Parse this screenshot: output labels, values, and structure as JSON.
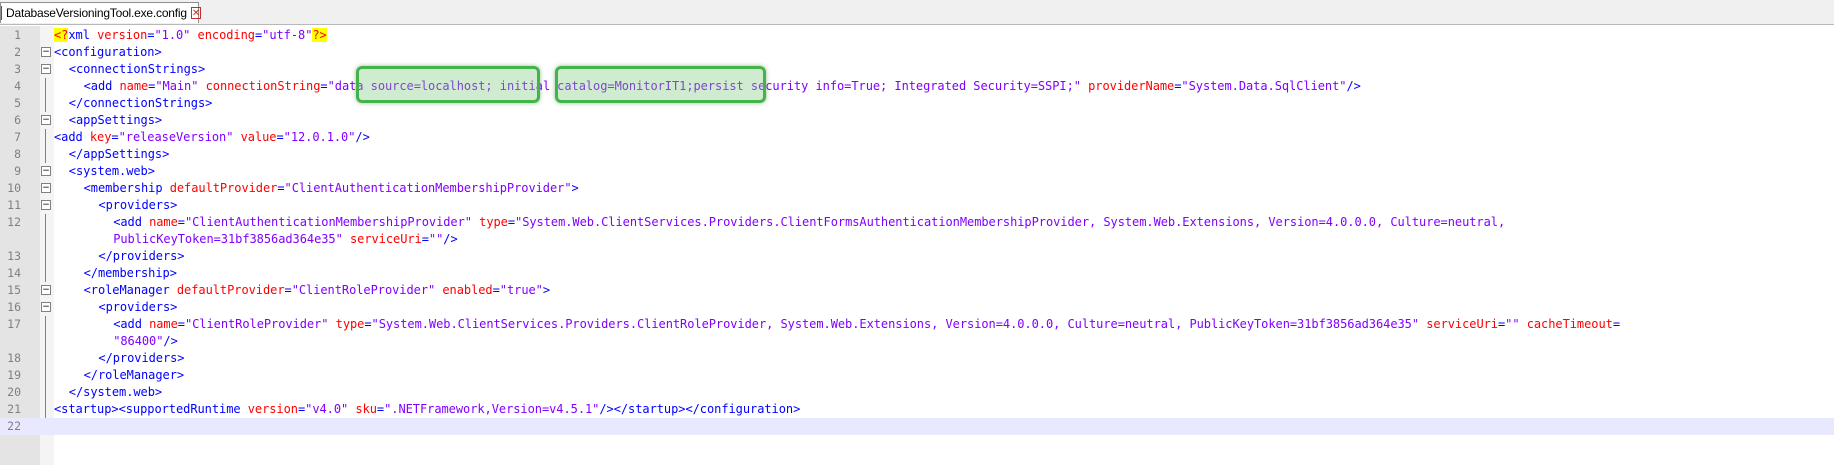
{
  "tab": {
    "title": "DatabaseVersioningTool.exe.config",
    "close_glyph": "✕"
  },
  "colors": {
    "tag": "#0000ff",
    "attribute": "#ff0000",
    "value": "#8000ff",
    "highlight": "#44b34c",
    "current_line": "#e8e8ff"
  },
  "lines": [
    {
      "num": "1",
      "fold": "",
      "indent": 0,
      "tokens": [
        [
          "pi",
          "<?"
        ],
        [
          "tag",
          "xml "
        ],
        [
          "attr",
          "version"
        ],
        [
          "tag",
          "="
        ],
        [
          "val",
          "\"1.0\""
        ],
        [
          "tag",
          " "
        ],
        [
          "attr",
          "encoding"
        ],
        [
          "tag",
          "="
        ],
        [
          "val",
          "\"utf-8\""
        ],
        [
          "pi",
          "?>"
        ]
      ]
    },
    {
      "num": "2",
      "fold": "minus",
      "indent": 0,
      "tokens": [
        [
          "tag",
          "<configuration>"
        ]
      ]
    },
    {
      "num": "3",
      "fold": "minus",
      "indent": 2,
      "tokens": [
        [
          "tag",
          "<connectionStrings>"
        ]
      ]
    },
    {
      "num": "4",
      "fold": "line",
      "indent": 4,
      "tokens": [
        [
          "tag",
          "<add "
        ],
        [
          "attr",
          "name"
        ],
        [
          "tag",
          "="
        ],
        [
          "val",
          "\"Main\""
        ],
        [
          "tag",
          " "
        ],
        [
          "attr",
          "connectionString"
        ],
        [
          "tag",
          "="
        ],
        [
          "val",
          "\"data source=localhost; initial catalog=MonitorIT1;persist security info=True; Integrated Security=SSPI;\""
        ],
        [
          "tag",
          " "
        ],
        [
          "attr",
          "providerName"
        ],
        [
          "tag",
          "="
        ],
        [
          "val",
          "\"System.Data.SqlClient\""
        ],
        [
          "tag",
          "/>"
        ]
      ]
    },
    {
      "num": "5",
      "fold": "line",
      "indent": 2,
      "tokens": [
        [
          "tag",
          "</connectionStrings>"
        ]
      ]
    },
    {
      "num": "6",
      "fold": "minus",
      "indent": 2,
      "tokens": [
        [
          "tag",
          "<appSettings>"
        ]
      ]
    },
    {
      "num": "7",
      "fold": "line",
      "indent": 0,
      "tokens": [
        [
          "tag",
          "<add "
        ],
        [
          "attr",
          "key"
        ],
        [
          "tag",
          "="
        ],
        [
          "val",
          "\"releaseVersion\""
        ],
        [
          "tag",
          " "
        ],
        [
          "attr",
          "value"
        ],
        [
          "tag",
          "="
        ],
        [
          "val",
          "\"12.0.1.0\""
        ],
        [
          "tag",
          "/>"
        ]
      ]
    },
    {
      "num": "8",
      "fold": "line",
      "indent": 2,
      "tokens": [
        [
          "tag",
          "</appSettings>"
        ]
      ]
    },
    {
      "num": "9",
      "fold": "minus",
      "indent": 2,
      "tokens": [
        [
          "tag",
          "<system.web>"
        ]
      ]
    },
    {
      "num": "10",
      "fold": "minus",
      "indent": 4,
      "tokens": [
        [
          "tag",
          "<membership "
        ],
        [
          "attr",
          "defaultProvider"
        ],
        [
          "tag",
          "="
        ],
        [
          "val",
          "\"ClientAuthenticationMembershipProvider\""
        ],
        [
          "tag",
          ">"
        ]
      ]
    },
    {
      "num": "11",
      "fold": "minus",
      "indent": 6,
      "tokens": [
        [
          "tag",
          "<providers>"
        ]
      ]
    },
    {
      "num": "12",
      "fold": "line",
      "indent": 8,
      "tokens": [
        [
          "tag",
          "<add "
        ],
        [
          "attr",
          "name"
        ],
        [
          "tag",
          "="
        ],
        [
          "val",
          "\"ClientAuthenticationMembershipProvider\""
        ],
        [
          "tag",
          " "
        ],
        [
          "attr",
          "type"
        ],
        [
          "tag",
          "="
        ],
        [
          "val",
          "\"System.Web.ClientServices.Providers.ClientFormsAuthenticationMembershipProvider, System.Web.Extensions, Version=4.0.0.0, Culture=neutral,"
        ]
      ]
    },
    {
      "num": "",
      "fold": "line",
      "indent": 8,
      "tokens": [
        [
          "val",
          "PublicKeyToken=31bf3856ad364e35\""
        ],
        [
          "tag",
          " "
        ],
        [
          "attr",
          "serviceUri"
        ],
        [
          "tag",
          "="
        ],
        [
          "val",
          "\"\""
        ],
        [
          "tag",
          "/>"
        ]
      ]
    },
    {
      "num": "13",
      "fold": "line",
      "indent": 6,
      "tokens": [
        [
          "tag",
          "</providers>"
        ]
      ]
    },
    {
      "num": "14",
      "fold": "line",
      "indent": 4,
      "tokens": [
        [
          "tag",
          "</membership>"
        ]
      ]
    },
    {
      "num": "15",
      "fold": "minus",
      "indent": 4,
      "tokens": [
        [
          "tag",
          "<roleManager "
        ],
        [
          "attr",
          "defaultProvider"
        ],
        [
          "tag",
          "="
        ],
        [
          "val",
          "\"ClientRoleProvider\""
        ],
        [
          "tag",
          " "
        ],
        [
          "attr",
          "enabled"
        ],
        [
          "tag",
          "="
        ],
        [
          "val",
          "\"true\""
        ],
        [
          "tag",
          ">"
        ]
      ]
    },
    {
      "num": "16",
      "fold": "minus",
      "indent": 6,
      "tokens": [
        [
          "tag",
          "<providers>"
        ]
      ]
    },
    {
      "num": "17",
      "fold": "line",
      "indent": 8,
      "tokens": [
        [
          "tag",
          "<add "
        ],
        [
          "attr",
          "name"
        ],
        [
          "tag",
          "="
        ],
        [
          "val",
          "\"ClientRoleProvider\""
        ],
        [
          "tag",
          " "
        ],
        [
          "attr",
          "type"
        ],
        [
          "tag",
          "="
        ],
        [
          "val",
          "\"System.Web.ClientServices.Providers.ClientRoleProvider, System.Web.Extensions, Version=4.0.0.0, Culture=neutral, PublicKeyToken=31bf3856ad364e35\""
        ],
        [
          "tag",
          " "
        ],
        [
          "attr",
          "serviceUri"
        ],
        [
          "tag",
          "="
        ],
        [
          "val",
          "\"\""
        ],
        [
          "tag",
          " "
        ],
        [
          "attr",
          "cacheTimeout"
        ],
        [
          "tag",
          "="
        ]
      ]
    },
    {
      "num": "",
      "fold": "line",
      "indent": 8,
      "tokens": [
        [
          "val",
          "\"86400\""
        ],
        [
          "tag",
          "/>"
        ]
      ]
    },
    {
      "num": "18",
      "fold": "line",
      "indent": 6,
      "tokens": [
        [
          "tag",
          "</providers>"
        ]
      ]
    },
    {
      "num": "19",
      "fold": "line",
      "indent": 4,
      "tokens": [
        [
          "tag",
          "</roleManager>"
        ]
      ]
    },
    {
      "num": "20",
      "fold": "line",
      "indent": 2,
      "tokens": [
        [
          "tag",
          "</system.web>"
        ]
      ]
    },
    {
      "num": "21",
      "fold": "line",
      "indent": 0,
      "tokens": [
        [
          "tag",
          "<startup><supportedRuntime "
        ],
        [
          "attr",
          "version"
        ],
        [
          "tag",
          "="
        ],
        [
          "val",
          "\"v4.0\""
        ],
        [
          "tag",
          " "
        ],
        [
          "attr",
          "sku"
        ],
        [
          "tag",
          "="
        ],
        [
          "val",
          "\".NETFramework,Version=v4.5.1\""
        ],
        [
          "tag",
          "/></startup></configuration>"
        ]
      ]
    },
    {
      "num": "22",
      "fold": "",
      "indent": 0,
      "current": true,
      "tokens": []
    }
  ]
}
